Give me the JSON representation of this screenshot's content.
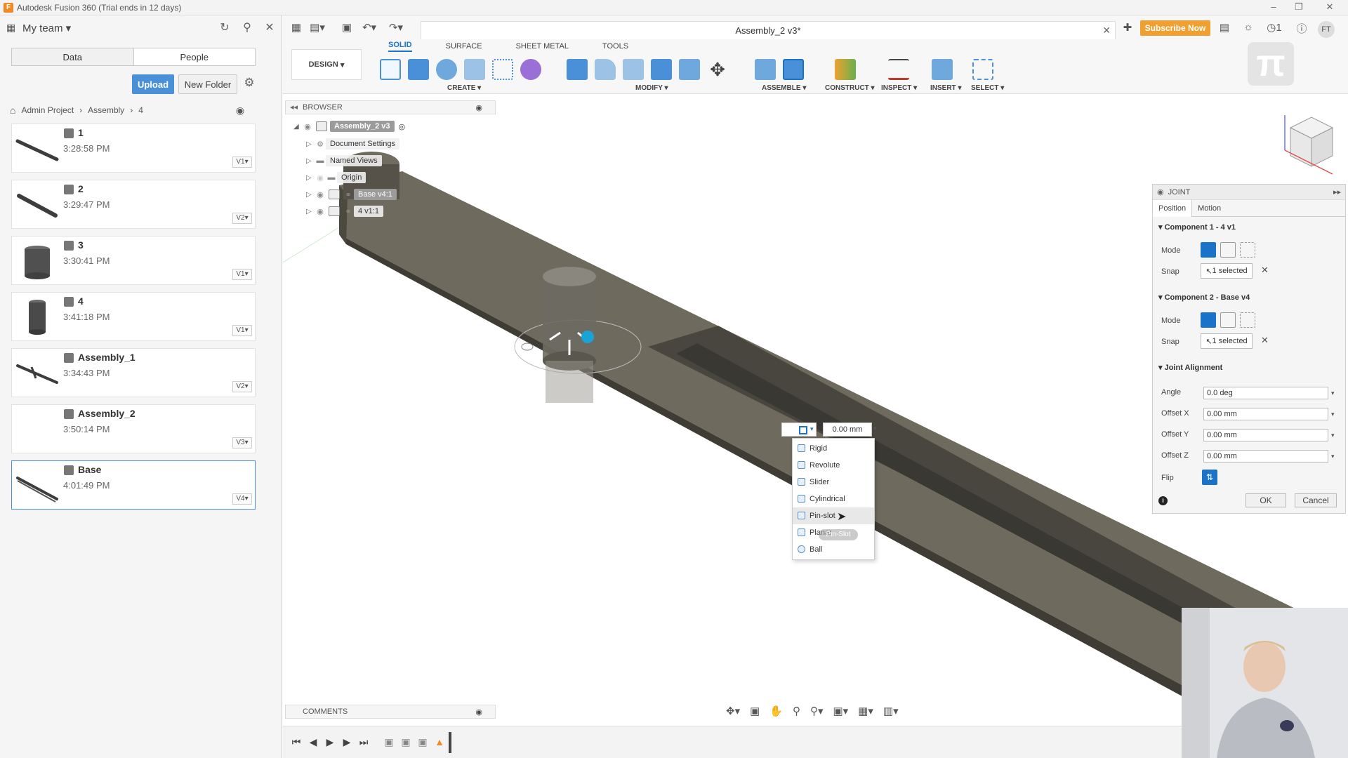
{
  "app": {
    "title": "Autodesk Fusion 360 (Trial ends in 12 days)"
  },
  "left_panel": {
    "team": "My team",
    "tabs": [
      "Data",
      "People"
    ],
    "upload": "Upload",
    "new_folder": "New Folder",
    "breadcrumb": [
      "Admin Project",
      "Assembly",
      "4"
    ],
    "files": [
      {
        "name": "1",
        "time": "3:28:58 PM",
        "version": "V1"
      },
      {
        "name": "2",
        "time": "3:29:47 PM",
        "version": "V2"
      },
      {
        "name": "3",
        "time": "3:30:41 PM",
        "version": "V1"
      },
      {
        "name": "4",
        "time": "3:41:18 PM",
        "version": "V1"
      },
      {
        "name": "Assembly_1",
        "time": "3:34:43 PM",
        "version": "V2"
      },
      {
        "name": "Assembly_2",
        "time": "3:50:14 PM",
        "version": "V3"
      },
      {
        "name": "Base",
        "time": "4:01:49 PM",
        "version": "V4"
      }
    ]
  },
  "toolbar": {
    "doc_title": "Assembly_2 v3*",
    "subscribe": "Subscribe Now",
    "user": "FT",
    "notifications": "1",
    "tabs": [
      "SOLID",
      "SURFACE",
      "SHEET METAL",
      "TOOLS"
    ],
    "active_tab": "SOLID",
    "workspace": "DESIGN",
    "groups": [
      "CREATE",
      "MODIFY",
      "ASSEMBLE",
      "CONSTRUCT",
      "INSPECT",
      "INSERT",
      "SELECT"
    ]
  },
  "browser": {
    "title": "BROWSER",
    "root": "Assembly_2 v3",
    "items": [
      "Document Settings",
      "Named Views",
      "Origin",
      "Base v4:1",
      "4 v1:1"
    ]
  },
  "comments": {
    "title": "COMMENTS"
  },
  "joint_panel": {
    "title": "JOINT",
    "tabs": [
      "Position",
      "Motion"
    ],
    "component1": "Component 1 - 4 v1",
    "component2": "Component 2 - Base v4",
    "mode_label": "Mode",
    "snap_label": "Snap",
    "snap_value": "1 selected",
    "alignment_title": "Joint Alignment",
    "angle_label": "Angle",
    "angle_value": "0.0 deg",
    "offset_x_label": "Offset X",
    "offset_x_value": "0.00 mm",
    "offset_y_label": "Offset Y",
    "offset_y_value": "0.00 mm",
    "offset_z_label": "Offset Z",
    "offset_z_value": "0.00 mm",
    "flip_label": "Flip",
    "ok": "OK",
    "cancel": "Cancel"
  },
  "joint_dropdown": {
    "offset": "0.00 mm",
    "items": [
      "Rigid",
      "Revolute",
      "Slider",
      "Cylindrical",
      "Pin-slot",
      "Planar",
      "Ball"
    ],
    "hovered": "Pin-slot",
    "tooltip": "Pin-Slot"
  },
  "colors": {
    "accent": "#1a73c9",
    "subscribe": "#f0a030",
    "upload": "#4a90d9",
    "model": "#5a564d"
  }
}
